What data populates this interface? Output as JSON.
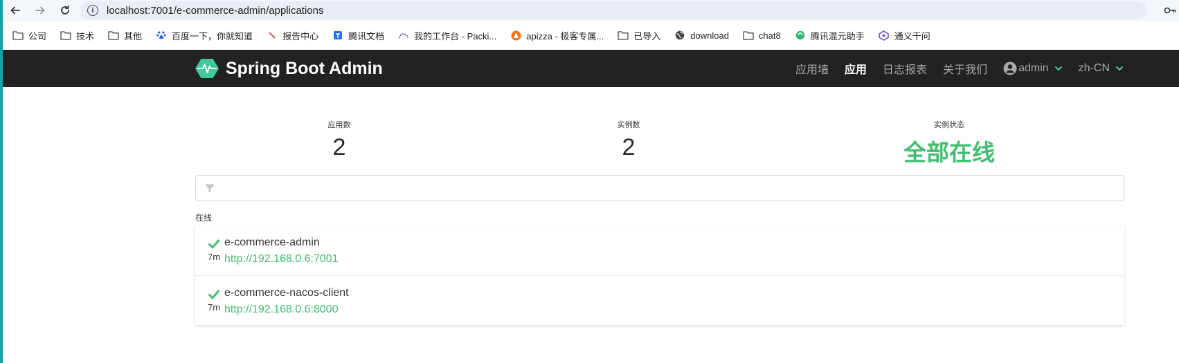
{
  "browser": {
    "url": "localhost:7001/e-commerce-admin/applications"
  },
  "bookmarks": [
    {
      "label": "公司",
      "icon": "folder-icon"
    },
    {
      "label": "技术",
      "icon": "folder-icon"
    },
    {
      "label": "其他",
      "icon": "folder-icon"
    },
    {
      "label": "百度一下，你就知道",
      "icon": "baidu-icon"
    },
    {
      "label": "报告中心",
      "icon": "slash-icon"
    },
    {
      "label": "腾讯文档",
      "icon": "tencent-docs-icon"
    },
    {
      "label": "我的工作台 - Packi...",
      "icon": "workbench-icon"
    },
    {
      "label": "apizza - 极客专属...",
      "icon": "apizza-icon"
    },
    {
      "label": "已导入",
      "icon": "folder-icon"
    },
    {
      "label": "download",
      "icon": "globe-icon"
    },
    {
      "label": "chat8",
      "icon": "folder-icon"
    },
    {
      "label": "腾讯混元助手",
      "icon": "hunyuan-icon"
    },
    {
      "label": "通义千问",
      "icon": "tongyi-icon"
    }
  ],
  "navbar": {
    "title": "Spring Boot Admin",
    "items": [
      "应用墙",
      "应用",
      "日志报表",
      "关于我们"
    ],
    "active_index": 1,
    "user": "admin",
    "language": "zh-CN"
  },
  "stats": {
    "applications_label": "应用数",
    "applications_value": "2",
    "instances_label": "实例数",
    "instances_value": "2",
    "status_label": "实例状态",
    "status_value": "全部在线"
  },
  "filter": {
    "placeholder": ""
  },
  "section": {
    "label": "在线"
  },
  "applications": [
    {
      "name": "e-commerce-admin",
      "url": "http://192.168.0.6:7001",
      "uptime": "7m"
    },
    {
      "name": "e-commerce-nacos-client",
      "url": "http://192.168.0.6:8000",
      "uptime": "7m"
    }
  ],
  "colors": {
    "accent": "#3fbf6f",
    "navbar": "#222222"
  }
}
